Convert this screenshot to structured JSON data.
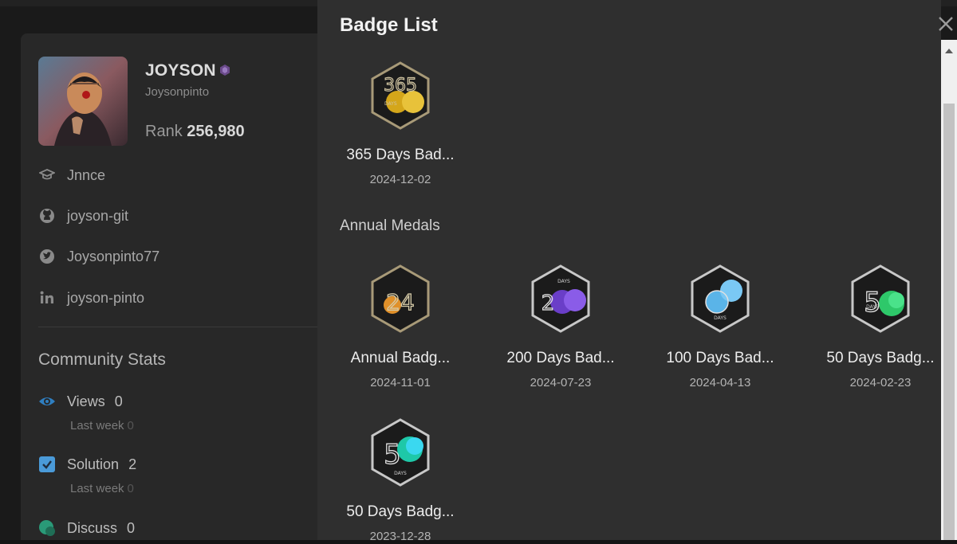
{
  "profile": {
    "username": "JOYSON",
    "handle": "Joysonpinto",
    "rank_label": "Rank",
    "rank_value": "256,980",
    "links": [
      {
        "icon": "graduation-cap-icon",
        "text": "Jnnce"
      },
      {
        "icon": "github-icon",
        "text": "joyson-git"
      },
      {
        "icon": "twitter-icon",
        "text": "Joysonpinto77"
      },
      {
        "icon": "linkedin-icon",
        "text": "joyson-pinto"
      }
    ]
  },
  "community": {
    "title": "Community Stats",
    "stats": [
      {
        "icon": "eye-icon",
        "name": "Views",
        "value": "0",
        "last_week_label": "Last week",
        "last_week_value": "0"
      },
      {
        "icon": "check-square-icon",
        "name": "Solution",
        "value": "2",
        "last_week_label": "Last week",
        "last_week_value": "0"
      },
      {
        "icon": "discuss-icon",
        "name": "Discuss",
        "value": "0"
      }
    ]
  },
  "drawer": {
    "title": "Badge List",
    "section_annual": "Annual Medals",
    "badges": [
      {
        "name": "365 Days Bad...",
        "date": "2024-12-02",
        "icon": "365-days-badge-icon"
      },
      {
        "name": "Annual Badg...",
        "date": "2024-11-01",
        "icon": "annual-2024-badge-icon"
      },
      {
        "name": "200 Days Bad...",
        "date": "2024-07-23",
        "icon": "200-days-badge-icon"
      },
      {
        "name": "100 Days Bad...",
        "date": "2024-04-13",
        "icon": "100-days-badge-icon"
      },
      {
        "name": "50 Days Badg...",
        "date": "2024-02-23",
        "icon": "50-days-badge-icon"
      },
      {
        "name": "50 Days Badg...",
        "date": "2023-12-28",
        "icon": "50-days-badge-icon"
      }
    ]
  },
  "colors": {
    "drawer_bg": "#2f2f2f",
    "page_bg": "#1a1a1a",
    "card_bg": "#282828",
    "accent_blue": "#2f7fc1"
  }
}
